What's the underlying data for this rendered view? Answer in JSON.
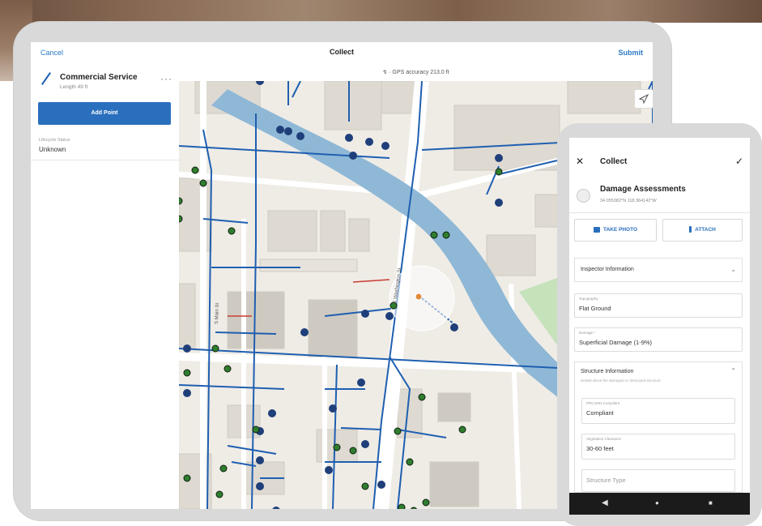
{
  "tablet": {
    "topbar": {
      "cancel": "Cancel",
      "title": "Collect",
      "submit": "Submit"
    },
    "gps": "↯ · GPS accuracy 213.0 ft",
    "feature": {
      "title": "Commercial Service",
      "subtitle": "Length 49 ft",
      "more": "···"
    },
    "add_point": "Add Point",
    "lifecycle": {
      "label": "Lifecycle Status",
      "value": "Unknown"
    },
    "map": {
      "street_main": "S Main St",
      "street_washington": "S Washington St"
    }
  },
  "phone": {
    "title": "Collect",
    "layer": "Damage Assessments",
    "coords": "34.055382°N 118.364142°W",
    "take_photo": "TAKE PHOTO",
    "attach": "ATTACH",
    "section1": "Inspector Information",
    "fields": [
      {
        "label": "Topography",
        "value": "Flat Ground"
      },
      {
        "label": "Damage *",
        "value": "Superficial Damage (1-9%)"
      }
    ],
    "section2": {
      "title": "Structure Information",
      "hint": "Details about the damaged or destroyed structure"
    },
    "sub_fields": [
      {
        "label": "PRC4291 Compliant",
        "value": "Compliant"
      },
      {
        "label": "Vegetation Clearance",
        "value": "30-60 feet"
      }
    ],
    "structure_type": "Structure Type",
    "navbar": {
      "back": "◀",
      "home": "●",
      "recents": "■"
    }
  },
  "colors": {
    "accent": "#2a6fbd",
    "line": "#1f5fb0",
    "water": "#8fb8d6",
    "park": "#bfe0b6",
    "point_green": "#2f7d2f",
    "point_blue": "#1f3f7a"
  }
}
